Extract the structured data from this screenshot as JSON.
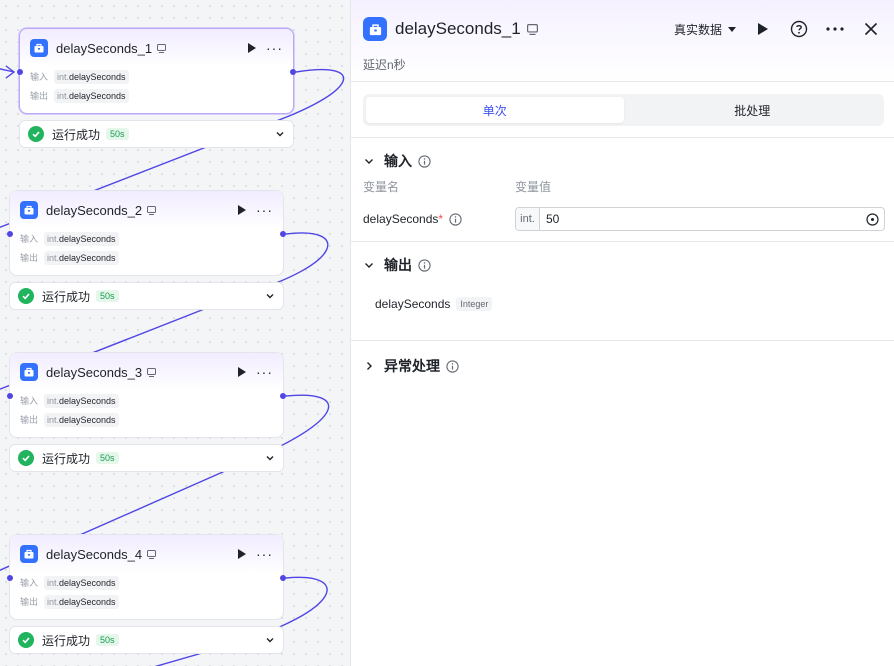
{
  "nodes": [
    {
      "title": "delaySeconds_1",
      "input_label": "输入",
      "input_type": "int.",
      "input_value": "delaySeconds",
      "output_label": "输出",
      "output_type": "int.",
      "output_value": "delaySeconds",
      "status": "运行成功",
      "duration": "50s",
      "selected": true
    },
    {
      "title": "delaySeconds_2",
      "input_label": "输入",
      "input_type": "int.",
      "input_value": "delaySeconds",
      "output_label": "输出",
      "output_type": "int.",
      "output_value": "delaySeconds",
      "status": "运行成功",
      "duration": "50s",
      "selected": false
    },
    {
      "title": "delaySeconds_3",
      "input_label": "输入",
      "input_type": "int.",
      "input_value": "delaySeconds",
      "output_label": "输出",
      "output_type": "int.",
      "output_value": "delaySeconds",
      "status": "运行成功",
      "duration": "50s",
      "selected": false
    },
    {
      "title": "delaySeconds_4",
      "input_label": "输入",
      "input_type": "int.",
      "input_value": "delaySeconds",
      "output_label": "输出",
      "output_type": "int.",
      "output_value": "delaySeconds",
      "status": "运行成功",
      "duration": "50s",
      "selected": false
    }
  ],
  "panel": {
    "title": "delaySeconds_1",
    "subtitle": "延迟n秒",
    "dataset_label": "真实数据",
    "tabs": [
      {
        "label": "单次",
        "active": true
      },
      {
        "label": "批处理",
        "active": false
      }
    ],
    "input_section": {
      "title": "输入",
      "col_name": "变量名",
      "col_value": "变量值",
      "var_name": "delaySeconds",
      "required_mark": "*",
      "var_type": "int.",
      "var_value": "50"
    },
    "output_section": {
      "title": "输出",
      "var_name": "delaySeconds",
      "var_type": "Integer"
    },
    "error_section": {
      "title": "异常处理"
    }
  },
  "colors": {
    "accent": "#3b4ff5",
    "node_icon": "#3371ff",
    "success": "#22b35e",
    "edge": "#4f46e5"
  },
  "icons": [
    "toolbox-icon",
    "play-icon",
    "more-icon",
    "help-icon",
    "close-icon",
    "info-icon",
    "chevron-down-icon",
    "chevron-right-icon",
    "check-circle-icon",
    "crosshair-icon"
  ]
}
